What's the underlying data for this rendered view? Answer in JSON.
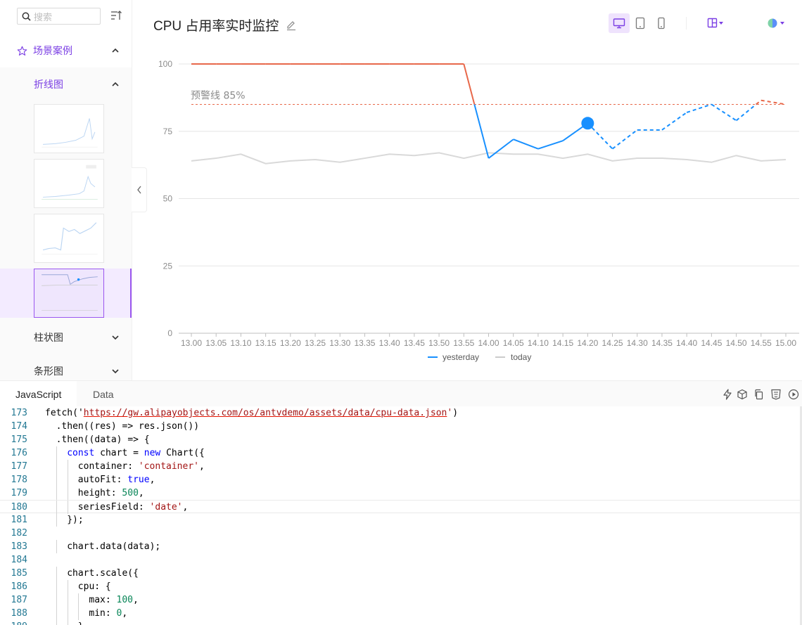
{
  "sidebar": {
    "search_placeholder": "搜索",
    "section_label": "场景案例",
    "sub_label": "折线图",
    "items": [
      {
        "label": "柱状图"
      },
      {
        "label": "条形图"
      }
    ]
  },
  "header": {
    "title": "CPU 占用率实时监控"
  },
  "chart_data": {
    "type": "line",
    "categories": [
      "13.00",
      "13.05",
      "13.10",
      "13.15",
      "13.20",
      "13.25",
      "13.30",
      "13.35",
      "13.40",
      "13.45",
      "13.50",
      "13.55",
      "14.00",
      "14.05",
      "14.10",
      "14.15",
      "14.20",
      "14.25",
      "14.30",
      "14.35",
      "14.40",
      "14.45",
      "14.50",
      "14.55",
      "15.00"
    ],
    "series": [
      {
        "name": "yesterday",
        "color": "#1890ff",
        "values": [
          100,
          100,
          100,
          100,
          100,
          100,
          100,
          100,
          100,
          100,
          100,
          100,
          65,
          72,
          68.5,
          71.5,
          78,
          68.5,
          75.5,
          75.5,
          82,
          85,
          79,
          86.5,
          85
        ]
      },
      {
        "name": "today",
        "color": "#cccccc",
        "values": [
          64,
          65,
          66.5,
          63,
          64,
          64.5,
          63.5,
          65,
          66.5,
          66,
          67,
          65,
          67,
          66.5,
          66.5,
          65,
          66.5,
          64,
          65,
          65,
          64.5,
          63.5,
          66,
          64,
          64.5
        ]
      }
    ],
    "yticks": [
      0,
      25,
      50,
      75,
      100
    ],
    "ylim": [
      0,
      100
    ],
    "threshold": {
      "value": 85,
      "label": "预警线 85%",
      "color": "#e8684a"
    },
    "highlight_index": 16,
    "solid_until_index": 16,
    "legend_placement": "bottom"
  },
  "editor": {
    "tabs": [
      "JavaScript",
      "Data"
    ],
    "lines": [
      {
        "n": "173",
        "indent": 0,
        "html": "fetch('<span class=\"url\">https://gw.alipayobjects.com/os/antvdemo/assets/data/cpu-data.json</span><span class=\"str\">'</span>)"
      },
      {
        "n": "174",
        "indent": 1,
        "html": ".then((res) => res.json())"
      },
      {
        "n": "175",
        "indent": 1,
        "html": ".then((data) => {"
      },
      {
        "n": "176",
        "indent": 2,
        "html": "<span class=\"kw\">const</span> chart = <span class=\"kw\">new</span> Chart({"
      },
      {
        "n": "177",
        "indent": 3,
        "html": "container: <span class=\"str\">'container'</span>,"
      },
      {
        "n": "178",
        "indent": 3,
        "html": "autoFit: <span class=\"kw\">true</span>,"
      },
      {
        "n": "179",
        "indent": 3,
        "html": "height: <span class=\"num\">500</span>,"
      },
      {
        "n": "180",
        "indent": 3,
        "html": "seriesField: <span class=\"str\">'date'</span>,"
      },
      {
        "n": "181",
        "indent": 2,
        "html": "});"
      },
      {
        "n": "182",
        "indent": 0,
        "html": ""
      },
      {
        "n": "183",
        "indent": 2,
        "html": "chart.data(data);"
      },
      {
        "n": "184",
        "indent": 0,
        "html": ""
      },
      {
        "n": "185",
        "indent": 2,
        "html": "chart.scale({"
      },
      {
        "n": "186",
        "indent": 3,
        "html": "cpu: {"
      },
      {
        "n": "187",
        "indent": 4,
        "html": "max: <span class=\"num\">100</span>,"
      },
      {
        "n": "188",
        "indent": 4,
        "html": "min: <span class=\"num\">0</span>,"
      },
      {
        "n": "189",
        "indent": 3,
        "html": "},"
      }
    ]
  }
}
